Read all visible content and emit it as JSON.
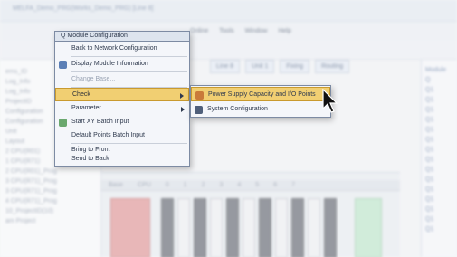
{
  "window": {
    "title": "MELFA_Demo_PRG(Works_Demo_PRG) [Line 8]",
    "menus": [
      "Online",
      "Tools",
      "Window",
      "Help"
    ]
  },
  "toolbar": {
    "tabs": [
      "Line 8",
      "Unit 1",
      "Fixing",
      "Routing"
    ]
  },
  "left_pane": {
    "lines": [
      "ems_ID",
      "Log_Info",
      "Log_Info",
      "ProjectID",
      "Configuration",
      "Configuration",
      "Unit",
      "Layout",
      "2 CPU(R01)",
      "1 CPU(R71)",
      "2 CPU(R01)_Prog",
      "3 CPU(R71)_Prog",
      "3 CPU(R71)_Prog",
      "4 CPU(R71)_Prog",
      "10_ProjectID(10)",
      "am Project"
    ]
  },
  "right_pane": {
    "lines": [
      "Module",
      "Q",
      "Q1",
      "Q1",
      "Q1",
      "Q1",
      "Q1",
      "Q1",
      "Q1",
      "Q1",
      "Q1",
      "Q1",
      "Q1",
      "Q1",
      "Q1",
      "Q1",
      "Q1"
    ]
  },
  "grid": {
    "headers": [
      "Base",
      "CPU",
      "0",
      "1",
      "2",
      "3",
      "4",
      "5",
      "6",
      "7"
    ]
  },
  "context_menu": {
    "title": "Q Module Configuration",
    "items": [
      "Back to Network Configuration",
      "Display Module Information",
      "Change Base...",
      "Check",
      "Parameter",
      "Start XY Batch Input",
      "Default Points Batch Input",
      "Bring to Front",
      "Send to Back"
    ]
  },
  "submenu": {
    "items": [
      "Power Supply Capacity and I/O Points",
      "System Configuration"
    ]
  },
  "colors": {
    "highlight": "#f1cf72",
    "menu_border": "#7d8ba3"
  }
}
